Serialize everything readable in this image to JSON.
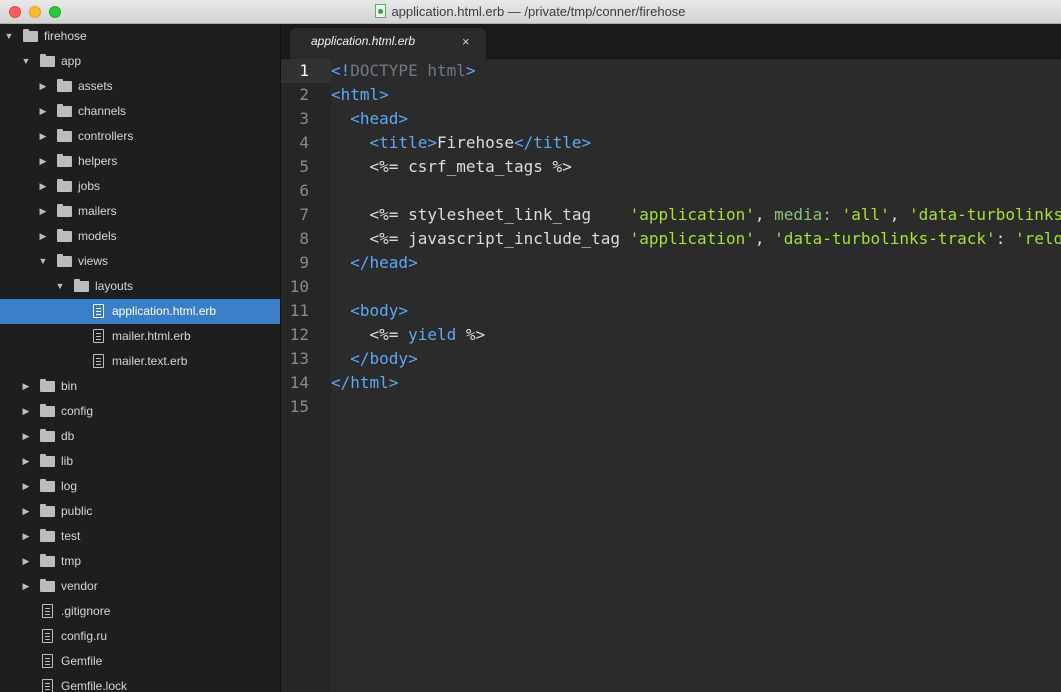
{
  "window": {
    "title": "application.html.erb — /private/tmp/conner/firehose"
  },
  "colors": {
    "tag": "#5ea8f7",
    "string": "#a6e22e",
    "key": "#8ec07c",
    "doctype": "#6d7a86",
    "selection": "#3b7ec8",
    "text": "#dddddd"
  },
  "tab": {
    "label": "application.html.erb",
    "close": "×"
  },
  "tree": [
    {
      "label": "firehose",
      "depth": 0,
      "kind": "folder",
      "state": "open"
    },
    {
      "label": "app",
      "depth": 1,
      "kind": "folder",
      "state": "open"
    },
    {
      "label": "assets",
      "depth": 2,
      "kind": "folder",
      "state": "closed"
    },
    {
      "label": "channels",
      "depth": 2,
      "kind": "folder",
      "state": "closed"
    },
    {
      "label": "controllers",
      "depth": 2,
      "kind": "folder",
      "state": "closed"
    },
    {
      "label": "helpers",
      "depth": 2,
      "kind": "folder",
      "state": "closed"
    },
    {
      "label": "jobs",
      "depth": 2,
      "kind": "folder",
      "state": "closed"
    },
    {
      "label": "mailers",
      "depth": 2,
      "kind": "folder",
      "state": "closed"
    },
    {
      "label": "models",
      "depth": 2,
      "kind": "folder",
      "state": "closed"
    },
    {
      "label": "views",
      "depth": 2,
      "kind": "folder",
      "state": "open"
    },
    {
      "label": "layouts",
      "depth": 3,
      "kind": "folder",
      "state": "open"
    },
    {
      "label": "application.html.erb",
      "depth": 4,
      "kind": "file",
      "selected": true
    },
    {
      "label": "mailer.html.erb",
      "depth": 4,
      "kind": "file"
    },
    {
      "label": "mailer.text.erb",
      "depth": 4,
      "kind": "file"
    },
    {
      "label": "bin",
      "depth": 1,
      "kind": "folder",
      "state": "closed"
    },
    {
      "label": "config",
      "depth": 1,
      "kind": "folder",
      "state": "closed"
    },
    {
      "label": "db",
      "depth": 1,
      "kind": "folder",
      "state": "closed"
    },
    {
      "label": "lib",
      "depth": 1,
      "kind": "folder",
      "state": "closed"
    },
    {
      "label": "log",
      "depth": 1,
      "kind": "folder",
      "state": "closed"
    },
    {
      "label": "public",
      "depth": 1,
      "kind": "folder",
      "state": "closed"
    },
    {
      "label": "test",
      "depth": 1,
      "kind": "folder",
      "state": "closed"
    },
    {
      "label": "tmp",
      "depth": 1,
      "kind": "folder",
      "state": "closed"
    },
    {
      "label": "vendor",
      "depth": 1,
      "kind": "folder",
      "state": "closed"
    },
    {
      "label": ".gitignore",
      "depth": 1,
      "kind": "file"
    },
    {
      "label": "config.ru",
      "depth": 1,
      "kind": "file"
    },
    {
      "label": "Gemfile",
      "depth": 1,
      "kind": "file"
    },
    {
      "label": "Gemfile.lock",
      "depth": 1,
      "kind": "file"
    }
  ],
  "editor": {
    "current_line": 1,
    "lines": [
      {
        "num": "1",
        "tokens": [
          [
            "tag",
            "<!"
          ],
          [
            "doctype",
            "DOCTYPE html"
          ],
          [
            "tag",
            ">"
          ]
        ]
      },
      {
        "num": "2",
        "tokens": [
          [
            "tag",
            "<html>"
          ]
        ]
      },
      {
        "num": "3",
        "tokens": [
          [
            "text",
            "  "
          ],
          [
            "tag",
            "<head>"
          ]
        ]
      },
      {
        "num": "4",
        "tokens": [
          [
            "text",
            "    "
          ],
          [
            "tag",
            "<title>"
          ],
          [
            "text",
            "Firehose"
          ],
          [
            "tag",
            "</title>"
          ]
        ]
      },
      {
        "num": "5",
        "tokens": [
          [
            "text",
            "    <%= csrf_meta_tags %>"
          ]
        ]
      },
      {
        "num": "6",
        "tokens": []
      },
      {
        "num": "7",
        "tokens": [
          [
            "text",
            "    <%= stylesheet_link_tag    "
          ],
          [
            "string",
            "'application'"
          ],
          [
            "text",
            ", "
          ],
          [
            "key",
            "media:"
          ],
          [
            "text",
            " "
          ],
          [
            "string",
            "'all'"
          ],
          [
            "text",
            ", "
          ],
          [
            "string",
            "'data-turbolinks-track'"
          ]
        ]
      },
      {
        "num": "8",
        "tokens": [
          [
            "text",
            "    <%= javascript_include_tag "
          ],
          [
            "string",
            "'application'"
          ],
          [
            "text",
            ", "
          ],
          [
            "string",
            "'data-turbolinks-track'"
          ],
          [
            "text",
            ": "
          ],
          [
            "string",
            "'reload'"
          ]
        ]
      },
      {
        "num": "9",
        "tokens": [
          [
            "text",
            "  "
          ],
          [
            "tag",
            "</head>"
          ]
        ]
      },
      {
        "num": "10",
        "tokens": []
      },
      {
        "num": "11",
        "tokens": [
          [
            "text",
            "  "
          ],
          [
            "tag",
            "<body>"
          ]
        ]
      },
      {
        "num": "12",
        "tokens": [
          [
            "text",
            "    <%= "
          ],
          [
            "tag",
            "yield"
          ],
          [
            "text",
            " %>"
          ]
        ]
      },
      {
        "num": "13",
        "tokens": [
          [
            "text",
            "  "
          ],
          [
            "tag",
            "</body>"
          ]
        ]
      },
      {
        "num": "14",
        "tokens": [
          [
            "tag",
            "</html>"
          ]
        ]
      },
      {
        "num": "15",
        "tokens": []
      }
    ]
  }
}
